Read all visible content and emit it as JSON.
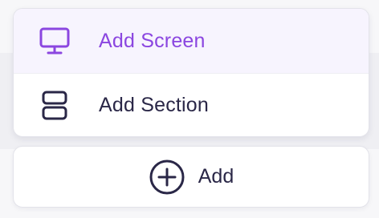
{
  "menu": {
    "items": [
      {
        "label": "Add Screen",
        "icon": "monitor-icon",
        "active": true,
        "color": "#8b46e0"
      },
      {
        "label": "Add Section",
        "icon": "section-layout-icon",
        "active": false,
        "color": "#2a2747"
      }
    ]
  },
  "add_button": {
    "label": "Add",
    "icon": "plus-circle-icon"
  }
}
